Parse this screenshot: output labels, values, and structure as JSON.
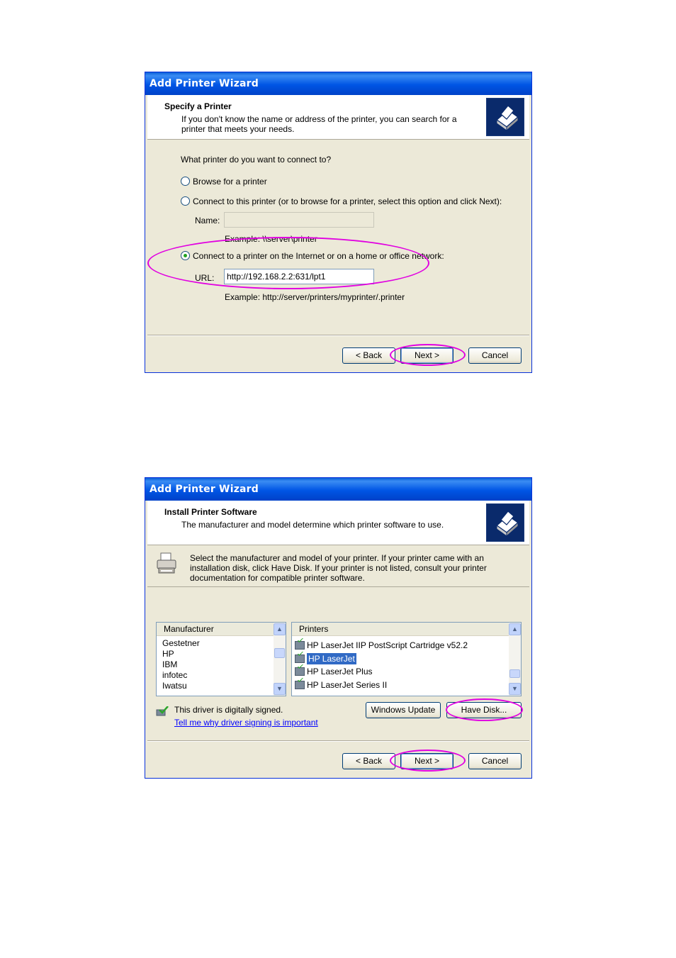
{
  "dialog1": {
    "title": "Add Printer Wizard",
    "header_title": "Specify a Printer",
    "header_desc": "If you don't know the name or address of the printer, you can search for a printer that meets your needs.",
    "question": "What printer do you want to connect to?",
    "radio_browse": "Browse for a printer",
    "radio_connect": "Connect to this printer (or to browse for a printer, select this option and click Next):",
    "name_label": "Name:",
    "name_value": "",
    "name_example": "Example: \\\\server\\printer",
    "radio_internet": "Connect to a printer on the Internet or on a home or office network:",
    "url_label": "URL:",
    "url_value": "http://192.168.2.2:631/lpt1",
    "url_example": "Example: http://server/printers/myprinter/.printer",
    "back_label": "< Back",
    "next_label": "Next >",
    "cancel_label": "Cancel",
    "selected_option": "internet"
  },
  "dialog2": {
    "title": "Add Printer Wizard",
    "header_title": "Install Printer Software",
    "header_desc": "The manufacturer and model determine which printer software to use.",
    "instructions": "Select the manufacturer and model of your printer. If your printer came with an installation disk, click Have Disk. If your printer is not listed, consult your printer documentation for compatible printer software.",
    "manufacturer_header": "Manufacturer",
    "manufacturers": [
      "Gestetner",
      "HP",
      "IBM",
      "infotec",
      "Iwatsu"
    ],
    "printers_header": "Printers",
    "printers": [
      "HP LaserJet IIP PostScript Cartridge v52.2",
      "HP LaserJet",
      "HP LaserJet Plus",
      "HP LaserJet Series II"
    ],
    "selected_printer": "HP LaserJet",
    "signed_text": "This driver is digitally signed.",
    "signing_link": "Tell me why driver signing is important",
    "windows_update_label": "Windows Update",
    "have_disk_label": "Have Disk...",
    "back_label": "< Back",
    "next_label": "Next >",
    "cancel_label": "Cancel"
  },
  "colors": {
    "annotation": "#e100e1",
    "titlebar": "#0055e5",
    "dialog_bg": "#ece9d8",
    "selection": "#316ac5"
  }
}
